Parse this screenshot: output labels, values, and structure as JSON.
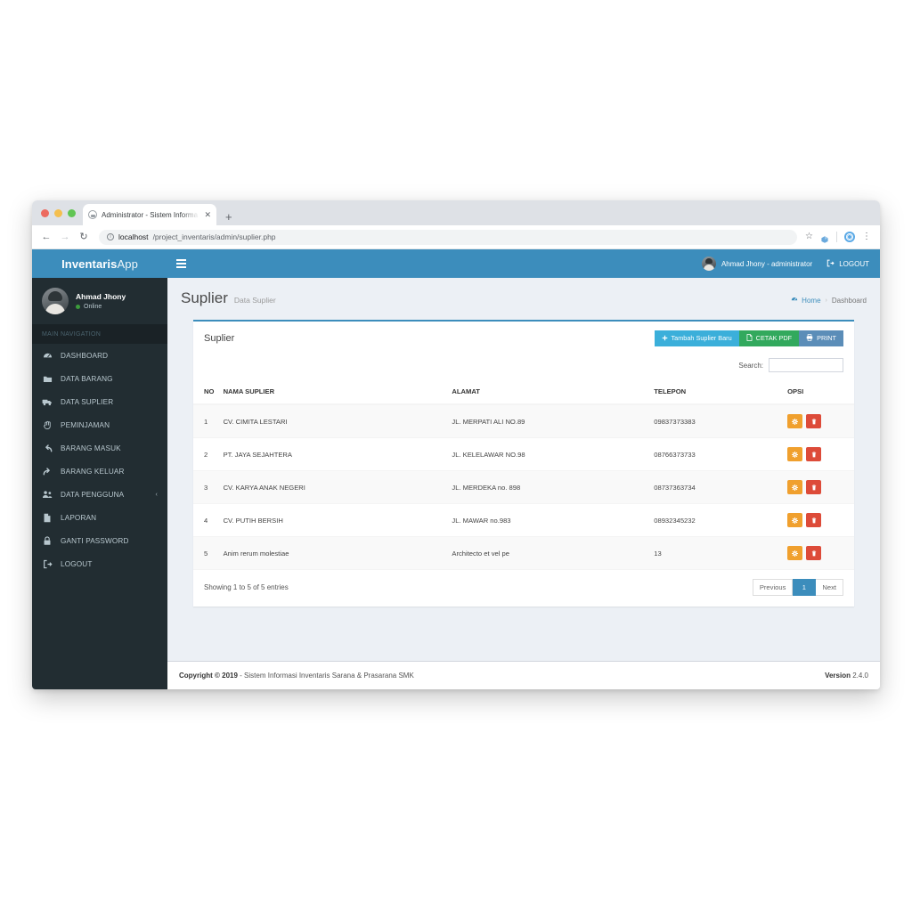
{
  "browser": {
    "tab_title": "Administrator - Sistem Informa",
    "tab_close": "✕",
    "new_tab": "+",
    "back": "←",
    "forward": "→",
    "reload": "↻",
    "info": "ⓘ",
    "url_host": "localhost",
    "url_path": "/project_inventaris/admin/suplier.php",
    "star": "☆",
    "menu": "⋮"
  },
  "sidebar": {
    "brand_bold": "Inventaris",
    "brand_light": "App",
    "user_name": "Ahmad Jhony",
    "user_status": "Online",
    "nav_header": "MAIN NAVIGATION",
    "items": [
      {
        "label": "DASHBOARD",
        "icon": "dashboard-icon",
        "arrow": ""
      },
      {
        "label": "DATA BARANG",
        "icon": "folder-icon",
        "arrow": ""
      },
      {
        "label": "DATA SUPLIER",
        "icon": "truck-icon",
        "arrow": ""
      },
      {
        "label": "PEMINJAMAN",
        "icon": "hand-icon",
        "arrow": ""
      },
      {
        "label": "BARANG MASUK",
        "icon": "arrow-back-icon",
        "arrow": ""
      },
      {
        "label": "BARANG KELUAR",
        "icon": "arrow-forward-icon",
        "arrow": ""
      },
      {
        "label": "DATA PENGGUNA",
        "icon": "users-icon",
        "arrow": "‹"
      },
      {
        "label": "LAPORAN",
        "icon": "document-icon",
        "arrow": ""
      },
      {
        "label": "GANTI PASSWORD",
        "icon": "lock-icon",
        "arrow": ""
      },
      {
        "label": "LOGOUT",
        "icon": "signout-icon",
        "arrow": ""
      }
    ]
  },
  "topbar": {
    "user_label": "Ahmad Jhony - administrator",
    "logout_label": "LOGOUT"
  },
  "page": {
    "title": "Suplier",
    "subtitle": "Data Suplier",
    "breadcrumb_home": "Home",
    "breadcrumb_sep": "›",
    "breadcrumb_current": "Dashboard"
  },
  "box": {
    "title": "Suplier",
    "buttons": [
      {
        "label": "Tambah Suplier Baru",
        "icon": "plus-icon",
        "style": "btn-info"
      },
      {
        "label": "CETAK PDF",
        "icon": "pdf-icon",
        "style": "btn-success"
      },
      {
        "label": "PRINT",
        "icon": "printer-icon",
        "style": "btn-print"
      }
    ],
    "search_label": "Search:",
    "search_value": "",
    "search_placeholder": ""
  },
  "table": {
    "columns": [
      "NO",
      "NAMA SUPLIER",
      "ALAMAT",
      "TELEPON",
      "OPSI"
    ],
    "rows": [
      {
        "no": "1",
        "nama": "CV. CIMITA LESTARI",
        "alamat": "JL. MERPATI ALI NO.89",
        "telepon": "09837373383"
      },
      {
        "no": "2",
        "nama": "PT. JAYA SEJAHTERA",
        "alamat": "JL. KELELAWAR NO.98",
        "telepon": "08766373733"
      },
      {
        "no": "3",
        "nama": "CV. KARYA ANAK NEGERI",
        "alamat": "JL. MERDEKA no. 898",
        "telepon": "08737363734"
      },
      {
        "no": "4",
        "nama": "CV. PUTIH BERSIH",
        "alamat": "JL. MAWAR no.983",
        "telepon": "08932345232"
      },
      {
        "no": "5",
        "nama": "Anim rerum molestiae",
        "alamat": "Architecto et vel pe",
        "telepon": "13"
      }
    ],
    "row_actions": {
      "edit": "gear-icon",
      "delete": "trash-icon"
    }
  },
  "footer_table": {
    "entries_info": "Showing 1 to 5 of 5 entries",
    "pagination": [
      {
        "label": "Previous",
        "active": false
      },
      {
        "label": "1",
        "active": true
      },
      {
        "label": "Next",
        "active": false
      }
    ]
  },
  "app_footer": {
    "copyright_bold": "Copyright © 2019",
    "copyright_rest": "- Sistem Informasi Inventaris Sarana & Prasarana SMK",
    "version_bold": "Version",
    "version_number": "2.4.0"
  },
  "colors": {
    "brand_blue": "#3c8dbc",
    "sidebar_dark": "#222d32",
    "btn_info": "#3bafda",
    "btn_success": "#32a95d",
    "btn_print": "#5b8db8",
    "edit_orange": "#f0a02e",
    "delete_red": "#dd4b39",
    "content_bg": "#ecf0f5"
  }
}
